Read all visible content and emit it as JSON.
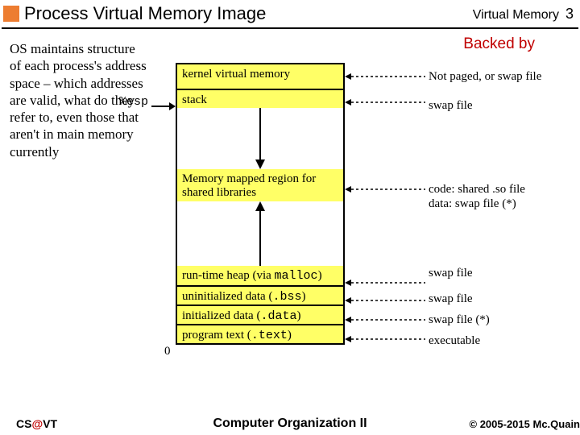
{
  "header": {
    "title": "Process Virtual Memory Image",
    "right_label": "Virtual Memory",
    "page_number": "3"
  },
  "left_text": "OS maintains structure of each process's address space – which addresses are valid, what do they refer to, even those that aren't in main memory currently",
  "backed_by": "Backed by",
  "esp_label": "%esp",
  "segments": {
    "kernel": "kernel virtual memory",
    "stack": "stack",
    "mmap_line1": "Memory mapped region for",
    "mmap_line2": "shared libraries",
    "heap_prefix": "run-time heap (via ",
    "heap_code": "malloc",
    "heap_suffix": ")",
    "bss_prefix": "uninitialized data (",
    "bss_code": ".bss",
    "bss_suffix": ")",
    "data_prefix": "initialized data (",
    "data_code": ".data",
    "data_suffix": ")",
    "text_prefix": "program text (",
    "text_code": ".text",
    "text_suffix": ")"
  },
  "annotations": {
    "kernel": "Not paged, or swap file",
    "stack": "swap file",
    "mmap_line1": "code: shared .so file",
    "mmap_line2": "data: swap file (*)",
    "heap": "swap file",
    "bss": "swap file",
    "data": "swap file (*)",
    "text": "executable"
  },
  "zero": "0",
  "footer": {
    "cs_prefix": "CS",
    "cs_at": "@",
    "cs_suffix": "VT",
    "course": "Computer Organization II",
    "copyright": "© 2005-2015 Mc.Quain"
  }
}
